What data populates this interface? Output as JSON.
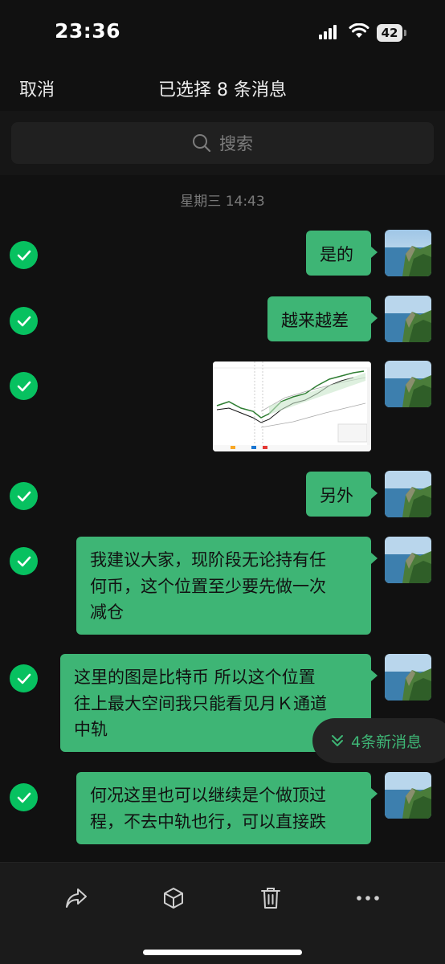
{
  "status_bar": {
    "time": "23:36",
    "battery_level": "42",
    "icons": [
      "signal-icon",
      "wifi-icon",
      "battery-icon"
    ]
  },
  "nav": {
    "cancel_label": "取消",
    "title": "已选择 8 条消息"
  },
  "search": {
    "placeholder": "搜索",
    "icon": "search-icon"
  },
  "chat": {
    "timestamp": "星期三 14:43",
    "messages": [
      {
        "type": "text",
        "text": "是的",
        "selected": true
      },
      {
        "type": "text",
        "text": "越来越差",
        "selected": true
      },
      {
        "type": "image",
        "description": "price chart screenshot",
        "selected": true
      },
      {
        "type": "text",
        "text": "另外",
        "selected": true
      },
      {
        "type": "text",
        "text": "我建议大家，现阶段无论持有任何币，这个位置至少要先做一次减仓",
        "lines": [
          "我建议大家，现阶段无论持有任",
          "何币，这个位置至少要先做一次",
          "减仓"
        ],
        "selected": true
      },
      {
        "type": "text",
        "text": "这里的图是比特币 所以这个位置往上最大空间我只能看见月K通道中轨",
        "lines": [
          "这里的图是比特币 所以这个位置",
          "往上最大空间我只能看见月Ｋ通道",
          "中轨"
        ],
        "selected": true
      },
      {
        "type": "text",
        "text": "何况这里也可以继续是个做顶过程，不去中轨也行，可以直接跌",
        "lines": [
          "何况这里也可以继续是个做顶过",
          "程，不去中轨也行，可以直接跌"
        ],
        "selected": true
      }
    ],
    "new_messages_label": "4条新消息"
  },
  "toolbar": {
    "items": [
      "forward-icon",
      "favorite-icon",
      "delete-icon",
      "more-icon"
    ]
  },
  "colors": {
    "accent": "#07c160",
    "bubble": "#3eb575",
    "background": "#111111"
  }
}
